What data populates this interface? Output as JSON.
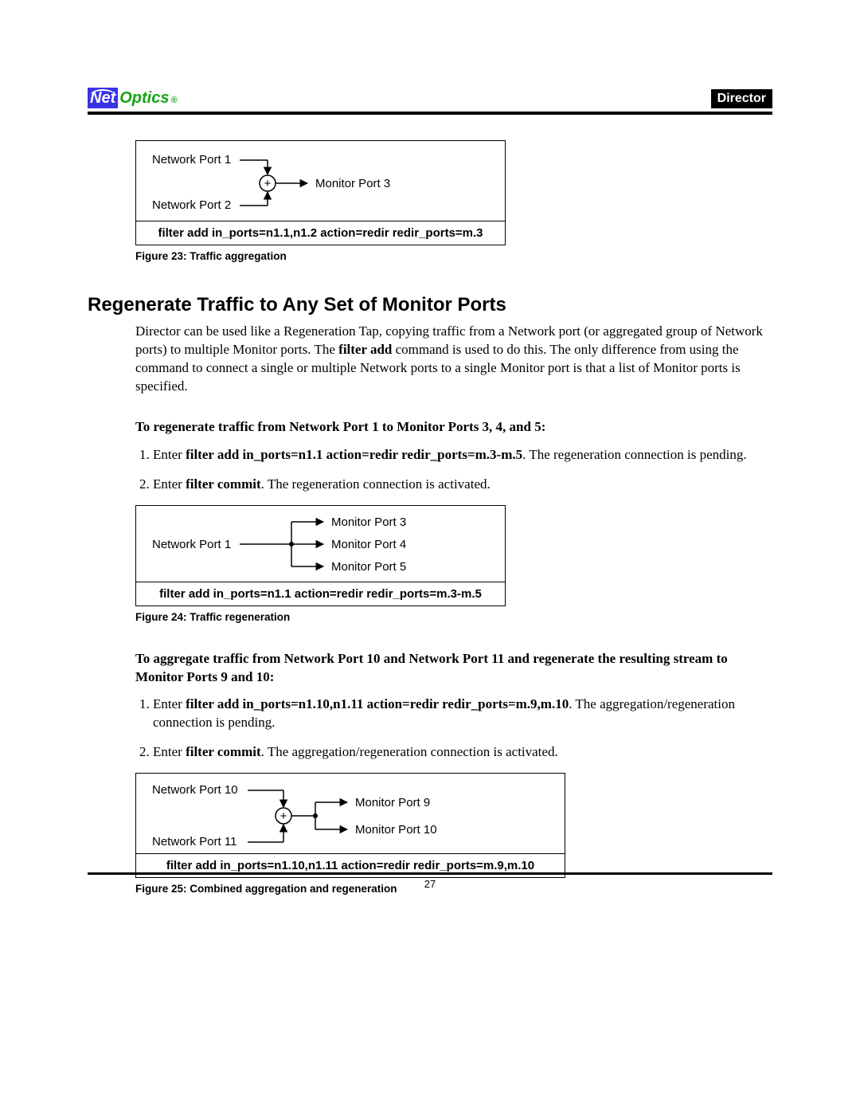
{
  "header": {
    "logo_net": "Net",
    "logo_optics": "Optics",
    "logo_reg": "®",
    "badge": "Director"
  },
  "fig23": {
    "np1": "Network Port 1",
    "np2": "Network Port 2",
    "mp3": "Monitor Port 3",
    "plus": "+",
    "cmd": "filter add in_ports=n1.1,n1.2 action=redir redir_ports=m.3",
    "caption": "Figure 23: Traffic aggregation"
  },
  "section_title": "Regenerate Traffic to Any Set of Monitor Ports",
  "para1_a": "Director can be used like a Regeneration Tap, copying traffic from a Network port (or aggregated group of Network ports) to multiple Monitor ports. The ",
  "para1_b": "filter add",
  "para1_c": " command is used to do this.  The only difference from using the command to connect a single or multiple Network ports to a single Monitor port is that a list of Monitor ports is specified.",
  "instrA_title": "To regenerate traffic from Network Port 1 to Monitor Ports 3, 4, and 5:",
  "stepsA": {
    "s1a": "Enter ",
    "s1b": "filter add in_ports=n1.1 action=redir redir_ports=m.3-m.5",
    "s1c": ". The regeneration connection is pending.",
    "s2a": "Enter ",
    "s2b": "filter commit",
    "s2c": ". The regeneration connection is activated."
  },
  "fig24": {
    "np1": "Network Port 1",
    "mp3": "Monitor Port 3",
    "mp4": "Monitor Port 4",
    "mp5": "Monitor Port 5",
    "cmd": "filter add in_ports=n1.1 action=redir redir_ports=m.3-m.5",
    "caption": "Figure 24: Traffic regeneration"
  },
  "instrB_title": "To aggregate traffic from Network Port 10 and Network Port 11 and regenerate the resulting stream to Monitor Ports 9 and 10:",
  "stepsB": {
    "s1a": "Enter ",
    "s1b": "filter add in_ports=n1.10,n1.11 action=redir redir_ports=m.9,m.10",
    "s1c": ". The aggregation/regeneration connection is pending.",
    "s2a": "Enter ",
    "s2b": "filter commit",
    "s2c": ". The aggregation/regeneration connection is activated."
  },
  "fig25": {
    "np10": "Network Port 10",
    "np11": "Network Port 11",
    "mp9": "Monitor Port 9",
    "mp10": "Monitor Port 10",
    "plus": "+",
    "cmd": "filter add in_ports=n1.10,n1.11 action=redir redir_ports=m.9,m.10",
    "caption": "Figure 25: Combined aggregation and regeneration"
  },
  "page_number": "27"
}
